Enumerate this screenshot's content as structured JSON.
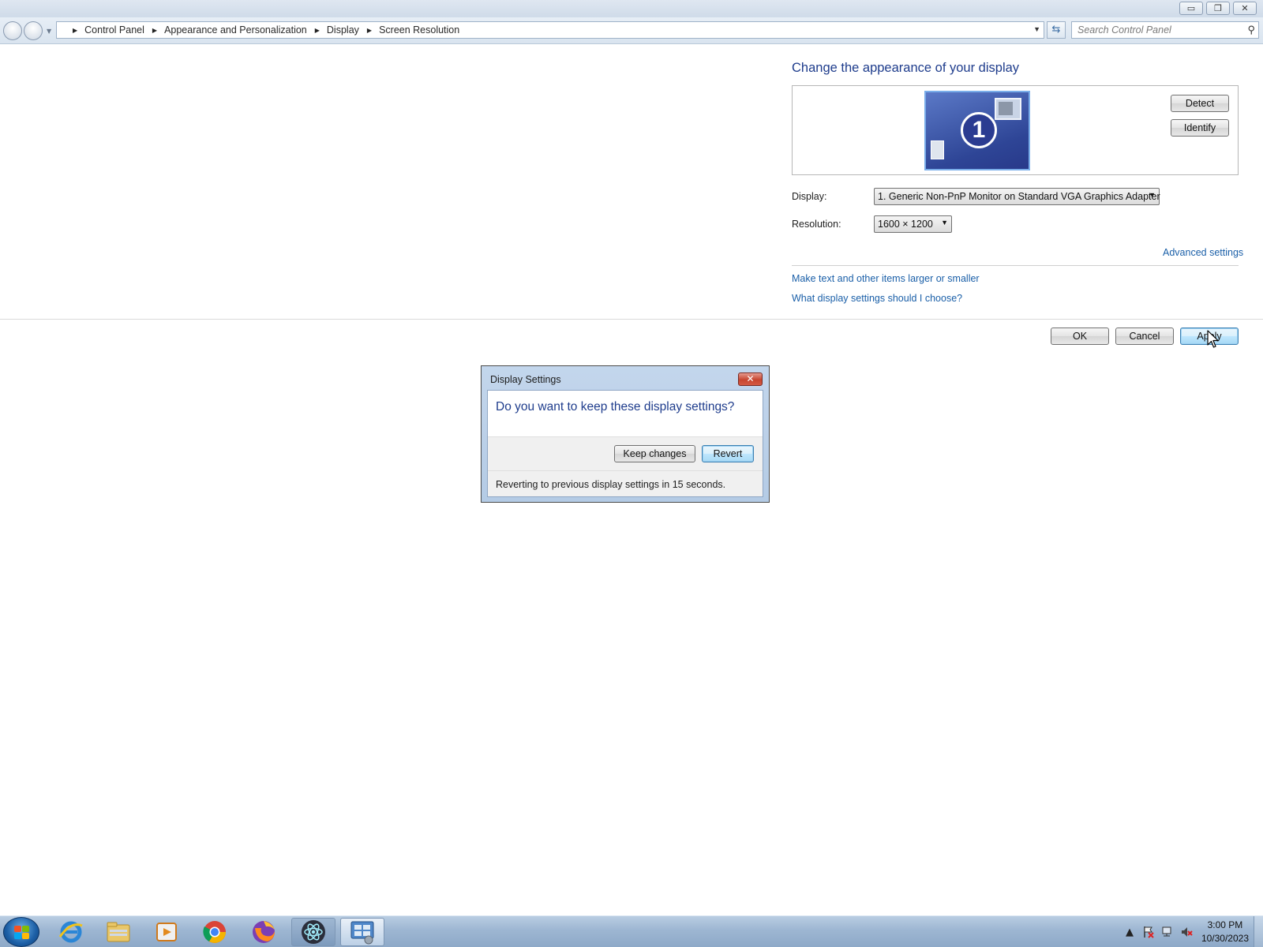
{
  "window": {
    "minimize_glyph": "▭",
    "restore_glyph": "❐",
    "close_glyph": "✕"
  },
  "addressbar": {
    "breadcrumbs": [
      "Control Panel",
      "Appearance and Personalization",
      "Display",
      "Screen Resolution"
    ],
    "search_placeholder": "Search Control Panel",
    "refresh_glyph": "⇆"
  },
  "main": {
    "heading": "Change the appearance of your display",
    "monitor_number": "1",
    "detect_label": "Detect",
    "identify_label": "Identify",
    "display_label": "Display:",
    "display_value": "1. Generic Non-PnP Monitor on Standard VGA Graphics Adapter",
    "resolution_label": "Resolution:",
    "resolution_value": "1600 × 1200",
    "advanced_settings": "Advanced settings",
    "link_text_size": "Make text and other items larger or smaller",
    "link_which_settings": "What display settings should I choose?",
    "ok_label": "OK",
    "cancel_label": "Cancel",
    "apply_label": "Apply"
  },
  "dialog": {
    "title": "Display Settings",
    "question": "Do you want to keep these display settings?",
    "keep_label": "Keep changes",
    "revert_label": "Revert",
    "countdown": "Reverting to previous display settings in 15 seconds."
  },
  "taskbar": {
    "apps": [
      "internet-explorer",
      "file-explorer",
      "media-player",
      "chrome",
      "firefox",
      "electron-app",
      "control-panel"
    ],
    "time": "3:00 PM",
    "date": "10/30/2023"
  }
}
